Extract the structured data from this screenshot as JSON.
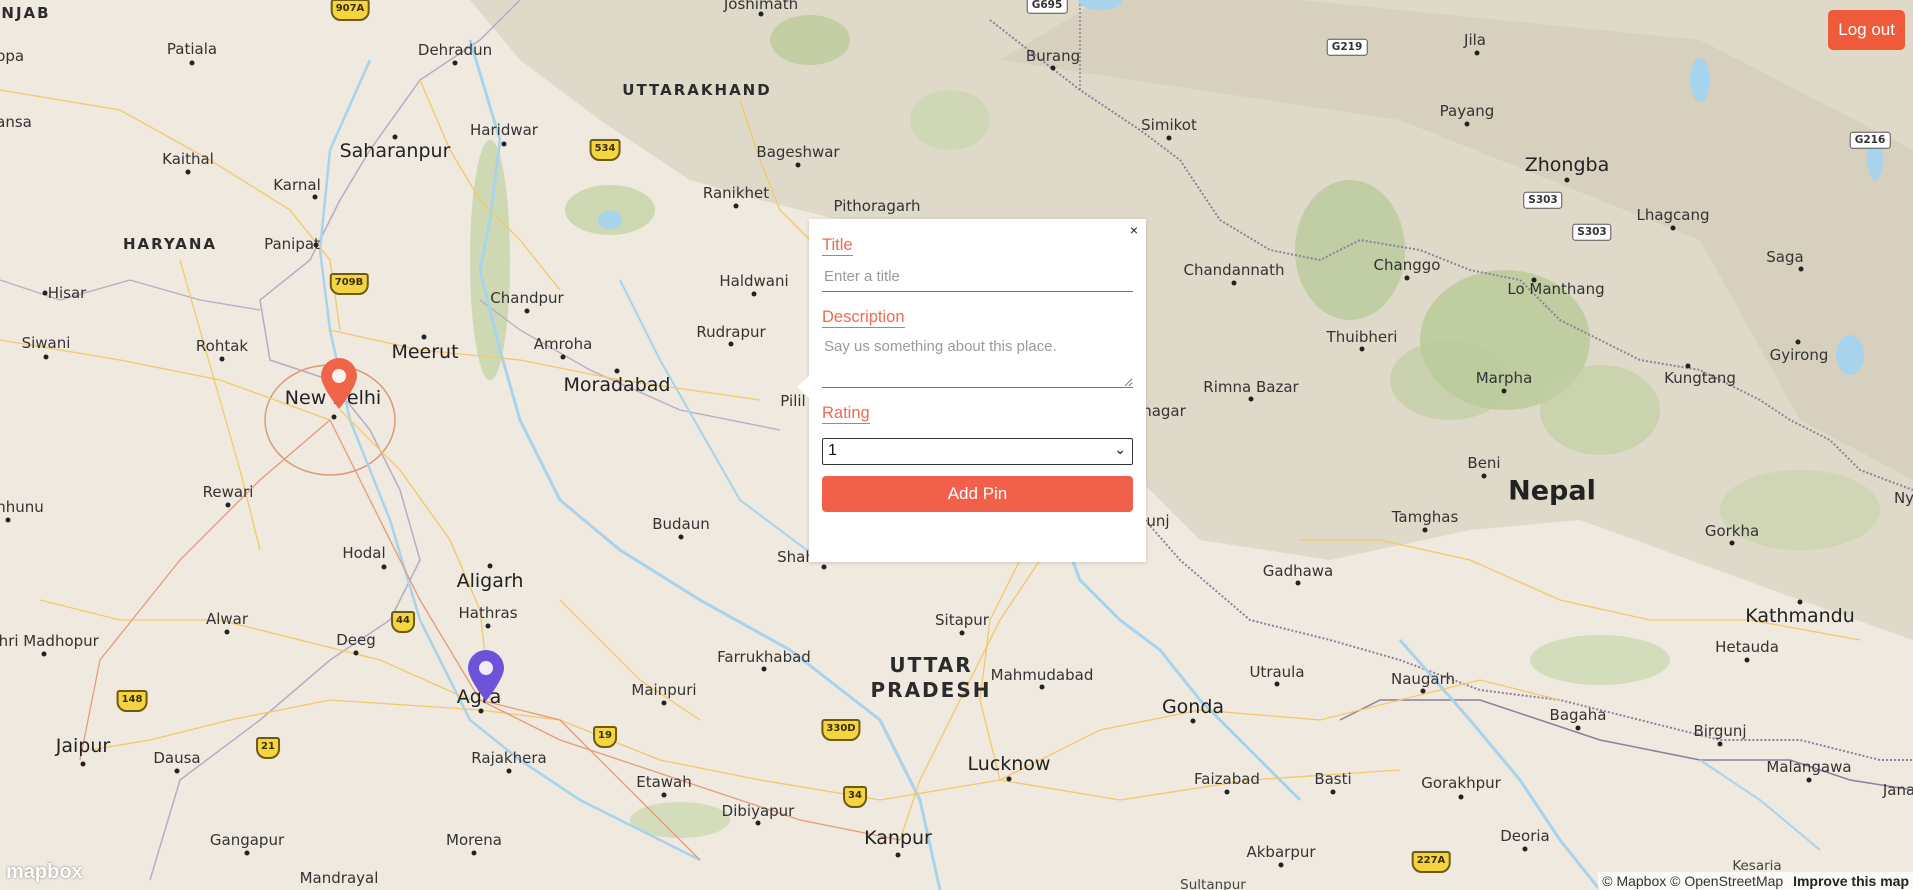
{
  "header": {
    "logout_label": "Log out"
  },
  "map": {
    "regions": {
      "punjab": "NJAB",
      "haryana": "HARYANA",
      "uttarakhand": "UTTARAKHAND",
      "uttar_pradesh_1": "UTTAR",
      "uttar_pradesh_2": "PRADESH",
      "nepal": "Nepal"
    },
    "places": {
      "joshimath": "Joshimath",
      "dehradun": "Dehradun",
      "patiala": "Patiala",
      "ppa": "ppa",
      "burang": "Burang",
      "jila": "Jila",
      "haridwar": "Haridwar",
      "saharanpur": "Saharanpur",
      "kaithal": "Kaithal",
      "karnal": "Karnal",
      "bageshwar": "Bageshwar",
      "ranikhet": "Ranikhet",
      "pithoragarh": "Pithoragarh",
      "simikot": "Simikot",
      "payang": "Payang",
      "zhongba": "Zhongba",
      "lhagcang": "Lhagcang",
      "panipat": "Panipat",
      "ansa": "ansa",
      "hisar": "Hisar",
      "chandpur": "Chandpur",
      "haldwani": "Haldwani",
      "chandannath": "Chandannath",
      "changgo": "Changgo",
      "saga": "Saga",
      "lo_manthang": "Lo Manthang",
      "siwani": "Siwani",
      "rohtak": "Rohtak",
      "meerut": "Meerut",
      "amroha": "Amroha",
      "rudrapur": "Rudrapur",
      "thuibheri": "Thuibheri",
      "gyirong": "Gyirong",
      "new_delhi": "New Delhi",
      "moradabad": "Moradabad",
      "pilibhit": "Pilil",
      "rimna_bazar": "Rimna Bazar",
      "marpha": "Marpha",
      "kungtang": "Kungtang",
      "nagar": "nagar",
      "rewari": "Rewari",
      "nhunu": "nhunu",
      "budaun": "Budaun",
      "beni": "Beni",
      "tamghas": "Tamghas",
      "unj": "unj",
      "gorkha": "Gorkha",
      "ny": "Ny",
      "hodal": "Hodal",
      "aligarh": "Aligarh",
      "shah": "Shah",
      "gadhawa": "Gadhawa",
      "hathras": "Hathras",
      "alwar": "Alwar",
      "sitapur": "Sitapur",
      "kathmandu": "Kathmandu",
      "shri_madhopur": "Shri Madhopur",
      "deeg": "Deeg",
      "farrukhabad": "Farrukhabad",
      "mahmudabad": "Mahmudabad",
      "hetauda": "Hetauda",
      "utraula": "Utraula",
      "naugarh": "Naugarh",
      "agra": "Agra",
      "mainpuri": "Mainpuri",
      "gonda": "Gonda",
      "bagaha": "Bagaha",
      "birgunj": "Birgunj",
      "jaipur": "Jaipur",
      "dausa": "Dausa",
      "rajakhera": "Rajakhera",
      "etawah": "Etawah",
      "lucknow": "Lucknow",
      "faizabad": "Faizabad",
      "basti": "Basti",
      "gorakhpur": "Gorakhpur",
      "malangawa": "Malangawa",
      "jana": "Jana",
      "dibiyapur": "Dibiyapur",
      "gangapur": "Gangapur",
      "morena": "Morena",
      "kanpur": "Kanpur",
      "akbarpur": "Akbarpur",
      "deoria": "Deoria",
      "mandrayal": "Mandrayal",
      "sultanpur": "Sultanpur",
      "kesaria": "Kesaria"
    },
    "highways": {
      "h907a": "907A",
      "g695": "G695",
      "g219": "G219",
      "g216": "G216",
      "h534": "534",
      "s303a": "S303",
      "s303b": "S303",
      "h709b": "709B",
      "h44": "44",
      "h148": "148",
      "h21": "21",
      "h19": "19",
      "h330d": "330D",
      "h34": "34",
      "h227a": "227A"
    }
  },
  "popup": {
    "close": "×",
    "title_label": "Title",
    "title_placeholder": "Enter a title",
    "description_label": "Description",
    "description_placeholder": "Say us something about this place.",
    "rating_label": "Rating",
    "rating_value": "1",
    "add_label": "Add Pin"
  },
  "attribution": {
    "text": "© Mapbox © OpenStreetMap",
    "improve": "Improve this map",
    "logo": "mapbox"
  },
  "colors": {
    "accent": "#f1604a",
    "pin_orange": "#f0654a",
    "pin_purple": "#6c53d8"
  }
}
